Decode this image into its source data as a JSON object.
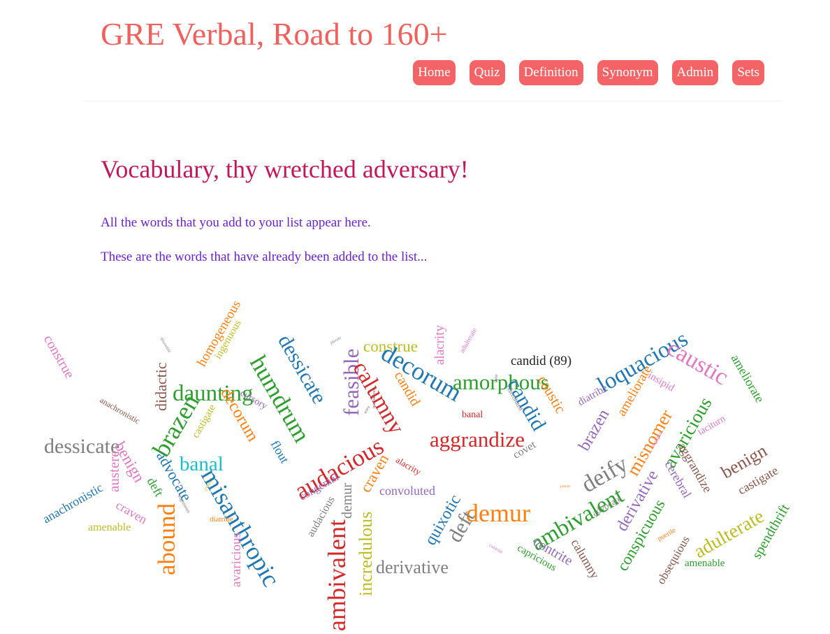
{
  "header": {
    "title": "GRE Verbal, Road to 160+"
  },
  "nav": {
    "items": [
      {
        "label": "Home"
      },
      {
        "label": "Quiz"
      },
      {
        "label": "Definition"
      },
      {
        "label": "Synonym"
      },
      {
        "label": "Admin"
      },
      {
        "label": "Sets"
      }
    ]
  },
  "main": {
    "heading": "Vocabulary, thy wretched adversary!",
    "intro": "All the words that you add to your list appear here.",
    "subintro": "These are the words that have already been added to the list..."
  },
  "colors": {
    "title": "#f0605d",
    "nav_button": "#f46366",
    "heading": "#c2185b",
    "paragraph": "#6a1fd6"
  },
  "word_cloud": {
    "tooltip": "candid (89)",
    "words": [
      {
        "text": "construe",
        "color": "#e377c2",
        "size": 20,
        "rot": 60
      },
      {
        "text": "homogeneous",
        "color": "#ff7f0e",
        "size": 19,
        "rot": -60
      },
      {
        "text": "ingenuous",
        "color": "#bcbd22",
        "size": 15,
        "rot": -60
      },
      {
        "text": "didactic",
        "color": "#8c564b",
        "size": 22,
        "rot": -90
      },
      {
        "text": "daunting",
        "color": "#2ca02c",
        "size": 33,
        "rot": 0
      },
      {
        "text": "dessicate",
        "color": "#1f77b4",
        "size": 30,
        "rot": 60
      },
      {
        "text": "humdrum",
        "color": "#2ca02c",
        "size": 35,
        "rot": 60
      },
      {
        "text": "construe",
        "color": "#bcbd22",
        "size": 23,
        "rot": 0
      },
      {
        "text": "feasible",
        "color": "#9467bd",
        "size": 31,
        "rot": -90
      },
      {
        "text": "alacrity",
        "color": "#e377c2",
        "size": 19,
        "rot": -90
      },
      {
        "text": "adulterate",
        "color": "#e377c2",
        "size": 10,
        "rot": -60
      },
      {
        "text": "candid (89)",
        "color": "#222222",
        "size": 19,
        "rot": 0
      },
      {
        "text": "loquacious",
        "color": "#1f77b4",
        "size": 33,
        "rot": -30
      },
      {
        "text": "caustic",
        "color": "#e377c2",
        "size": 34,
        "rot": 30
      },
      {
        "text": "ameliorate",
        "color": "#2ca02c",
        "size": 18,
        "rot": 60
      },
      {
        "text": "decorum",
        "color": "#1f77b4",
        "size": 36,
        "rot": 30
      },
      {
        "text": "amorphous",
        "color": "#2ca02c",
        "size": 31,
        "rot": 0
      },
      {
        "text": "calumny",
        "color": "#d62728",
        "size": 33,
        "rot": 60
      },
      {
        "text": "candid",
        "color": "#1f77b4",
        "size": 30,
        "rot": 60
      },
      {
        "text": "caustic",
        "color": "#ff7f0e",
        "size": 21,
        "rot": 60
      },
      {
        "text": "insipid",
        "color": "#e377c2",
        "size": 15,
        "rot": 30
      },
      {
        "text": "anachronistic",
        "color": "#8c564b",
        "size": 12,
        "rot": 30
      },
      {
        "text": "brazen",
        "color": "#2ca02c",
        "size": 36,
        "rot": -60
      },
      {
        "text": "castigate",
        "color": "#bcbd22",
        "size": 15,
        "rot": -60
      },
      {
        "text": "decorum",
        "color": "#ff7f0e",
        "size": 24,
        "rot": 60
      },
      {
        "text": "cursory",
        "color": "#9467bd",
        "size": 14,
        "rot": 30
      },
      {
        "text": "candid",
        "color": "#ff7f0e",
        "size": 20,
        "rot": 60
      },
      {
        "text": "banal",
        "color": "#d62728",
        "size": 14,
        "rot": 0
      },
      {
        "text": "ameliorate",
        "color": "#ff7f0e",
        "size": 19,
        "rot": -60
      },
      {
        "text": "diatribe",
        "color": "#9467bd",
        "size": 15,
        "rot": -30
      },
      {
        "text": "dessicate",
        "color": "#7f7f7f",
        "size": 30,
        "rot": 0
      },
      {
        "text": "banal",
        "color": "#17becf",
        "size": 29,
        "rot": 0
      },
      {
        "text": "aggrandize",
        "color": "#d62728",
        "size": 31,
        "rot": 0
      },
      {
        "text": "brazen",
        "color": "#9467bd",
        "size": 24,
        "rot": -60
      },
      {
        "text": "misnomer",
        "color": "#ff7f0e",
        "size": 26,
        "rot": -60
      },
      {
        "text": "avaricious",
        "color": "#2ca02c",
        "size": 27,
        "rot": -60
      },
      {
        "text": "taciturn",
        "color": "#e377c2",
        "size": 14,
        "rot": -30
      },
      {
        "text": "austere",
        "color": "#e377c2",
        "size": 21,
        "rot": -90
      },
      {
        "text": "benign",
        "color": "#e377c2",
        "size": 23,
        "rot": 60
      },
      {
        "text": "advocate",
        "color": "#1f77b4",
        "size": 22,
        "rot": 60
      },
      {
        "text": "flout",
        "color": "#1f77b4",
        "size": 18,
        "rot": 60
      },
      {
        "text": "audacious",
        "color": "#d62728",
        "size": 35,
        "rot": -30
      },
      {
        "text": "craven",
        "color": "#ff7f0e",
        "size": 22,
        "rot": -60
      },
      {
        "text": "covet",
        "color": "#7f7f7f",
        "size": 16,
        "rot": -30
      },
      {
        "text": "deify",
        "color": "#7f7f7f",
        "size": 34,
        "rot": -30
      },
      {
        "text": "aggrandize",
        "color": "#8c564b",
        "size": 18,
        "rot": 60
      },
      {
        "text": "benign",
        "color": "#8c564b",
        "size": 26,
        "rot": -30
      },
      {
        "text": "castigate",
        "color": "#8c564b",
        "size": 18,
        "rot": -30
      },
      {
        "text": "anachronistic",
        "color": "#1f77b4",
        "size": 18,
        "rot": -30
      },
      {
        "text": "deft",
        "color": "#2ca02c",
        "size": 18,
        "rot": 60
      },
      {
        "text": "covet",
        "color": "#bcbd22",
        "size": 9,
        "rot": -60
      },
      {
        "text": "misanthropic",
        "color": "#1f77b4",
        "size": 36,
        "rot": 60
      },
      {
        "text": "congenial",
        "color": "#9467bd",
        "size": 16,
        "rot": -30
      },
      {
        "text": "alacrity",
        "color": "#d62728",
        "size": 13,
        "rot": 30
      },
      {
        "text": "convoluted",
        "color": "#9467bd",
        "size": 18,
        "rot": 0
      },
      {
        "text": "quixotic",
        "color": "#1f77b4",
        "size": 24,
        "rot": -60
      },
      {
        "text": "demur",
        "color": "#ff7f0e",
        "size": 36,
        "rot": 0
      },
      {
        "text": "ambivalent",
        "color": "#2ca02c",
        "size": 33,
        "rot": -30
      },
      {
        "text": "derivative",
        "color": "#9467bd",
        "size": 24,
        "rot": -60
      },
      {
        "text": "cerebral",
        "color": "#9467bd",
        "size": 18,
        "rot": 60
      },
      {
        "text": "craven",
        "color": "#e377c2",
        "size": 18,
        "rot": 30
      },
      {
        "text": "amenable",
        "color": "#bcbd22",
        "size": 16,
        "rot": 0
      },
      {
        "text": "abound",
        "color": "#ff7f0e",
        "size": 35,
        "rot": -90
      },
      {
        "text": "diatribe",
        "color": "#ff7f0e",
        "size": 11,
        "rot": 0
      },
      {
        "text": "avaricious",
        "color": "#e377c2",
        "size": 19,
        "rot": -90
      },
      {
        "text": "audacious",
        "color": "#7f7f7f",
        "size": 16,
        "rot": -60
      },
      {
        "text": "demur",
        "color": "#7f7f7f",
        "size": 20,
        "rot": -90
      },
      {
        "text": "deft",
        "color": "#7f7f7f",
        "size": 30,
        "rot": -60
      },
      {
        "text": "advocate",
        "color": "#7f7f7f",
        "size": 13,
        "rot": -30
      },
      {
        "text": "adulterate",
        "color": "#bcbd22",
        "size": 28,
        "rot": -30
      },
      {
        "text": "spendthrift",
        "color": "#2ca02c",
        "size": 20,
        "rot": -60
      },
      {
        "text": "conspicuous",
        "color": "#2ca02c",
        "size": 23,
        "rot": -60
      },
      {
        "text": "obsequious",
        "color": "#8c564b",
        "size": 17,
        "rot": -60
      },
      {
        "text": "puerile",
        "color": "#ff7f0e",
        "size": 10,
        "rot": -30
      },
      {
        "text": "ambivalent",
        "color": "#d62728",
        "size": 36,
        "rot": -90
      },
      {
        "text": "incredulous",
        "color": "#bcbd22",
        "size": 26,
        "rot": -90
      },
      {
        "text": "derivative",
        "color": "#7f7f7f",
        "size": 26,
        "rot": 0
      },
      {
        "text": "contrite",
        "color": "#9467bd",
        "size": 20,
        "rot": 30
      },
      {
        "text": "capricious",
        "color": "#2ca02c",
        "size": 15,
        "rot": 30
      },
      {
        "text": "calumny",
        "color": "#8c564b",
        "size": 18,
        "rot": 60
      },
      {
        "text": "amenable",
        "color": "#2ca02c",
        "size": 15,
        "rot": 0
      },
      {
        "text": "contrite",
        "color": "#e377c2",
        "size": 7,
        "rot": 30
      },
      {
        "text": "dissemble",
        "color": "#7f7f7f",
        "size": 6,
        "rot": 60
      },
      {
        "text": "placate",
        "color": "#7f7f7f",
        "size": 6,
        "rot": -30
      },
      {
        "text": "belie",
        "color": "#7f7f7f",
        "size": 6,
        "rot": -90
      },
      {
        "text": "convoluted",
        "color": "#7f7f7f",
        "size": 9,
        "rot": 60
      },
      {
        "text": "incredulous",
        "color": "#8c564b",
        "size": 6,
        "rot": -90
      },
      {
        "text": "wary",
        "color": "#8c564b",
        "size": 6,
        "rot": -60
      },
      {
        "text": "negligent",
        "color": "#e377c2",
        "size": 7,
        "rot": -60
      },
      {
        "text": "paucity",
        "color": "#ff7f0e",
        "size": 5,
        "rot": 0
      },
      {
        "text": "ingenuous",
        "color": "#7f7f7f",
        "size": 7,
        "rot": 60
      }
    ]
  }
}
